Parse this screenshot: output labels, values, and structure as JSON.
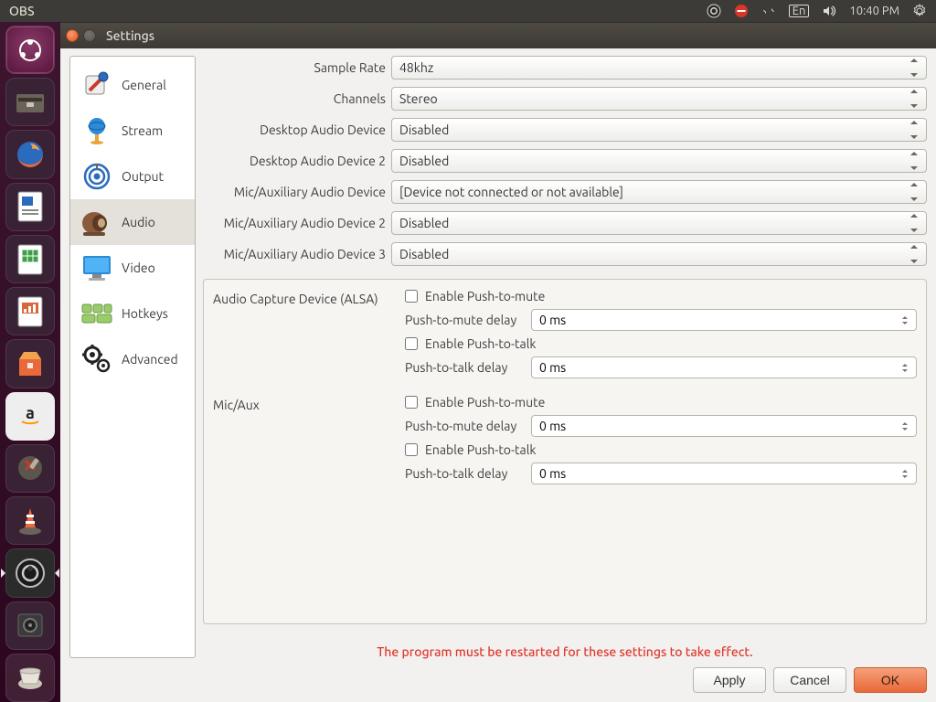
{
  "menubar": {
    "title": "OBS",
    "clock": "10:40 PM",
    "lang": "En"
  },
  "window": {
    "title": "Settings"
  },
  "sidebar": {
    "items": [
      {
        "label": "General"
      },
      {
        "label": "Stream"
      },
      {
        "label": "Output"
      },
      {
        "label": "Audio"
      },
      {
        "label": "Video"
      },
      {
        "label": "Hotkeys"
      },
      {
        "label": "Advanced"
      }
    ]
  },
  "audio": {
    "sample_rate": {
      "label": "Sample Rate",
      "value": "48khz"
    },
    "channels": {
      "label": "Channels",
      "value": "Stereo"
    },
    "desktop1": {
      "label": "Desktop Audio Device",
      "value": "Disabled"
    },
    "desktop2": {
      "label": "Desktop Audio Device 2",
      "value": "Disabled"
    },
    "mic1": {
      "label": "Mic/Auxiliary Audio Device",
      "value": "[Device not connected or not available]"
    },
    "mic2": {
      "label": "Mic/Auxiliary Audio Device 2",
      "value": "Disabled"
    },
    "mic3": {
      "label": "Mic/Auxiliary Audio Device 3",
      "value": "Disabled"
    }
  },
  "group1": {
    "title": "Audio Capture Device (ALSA)",
    "ptm_enable": "Enable Push-to-mute",
    "ptm_delay_label": "Push-to-mute delay",
    "ptm_delay_value": "0 ms",
    "ptt_enable": "Enable Push-to-talk",
    "ptt_delay_label": "Push-to-talk delay",
    "ptt_delay_value": "0 ms"
  },
  "group2": {
    "title": "Mic/Aux",
    "ptm_enable": "Enable Push-to-mute",
    "ptm_delay_label": "Push-to-mute delay",
    "ptm_delay_value": "0 ms",
    "ptt_enable": "Enable Push-to-talk",
    "ptt_delay_label": "Push-to-talk delay",
    "ptt_delay_value": "0 ms"
  },
  "warning": "The program must be restarted for these settings to take effect.",
  "buttons": {
    "apply": "Apply",
    "cancel": "Cancel",
    "ok": "OK"
  }
}
